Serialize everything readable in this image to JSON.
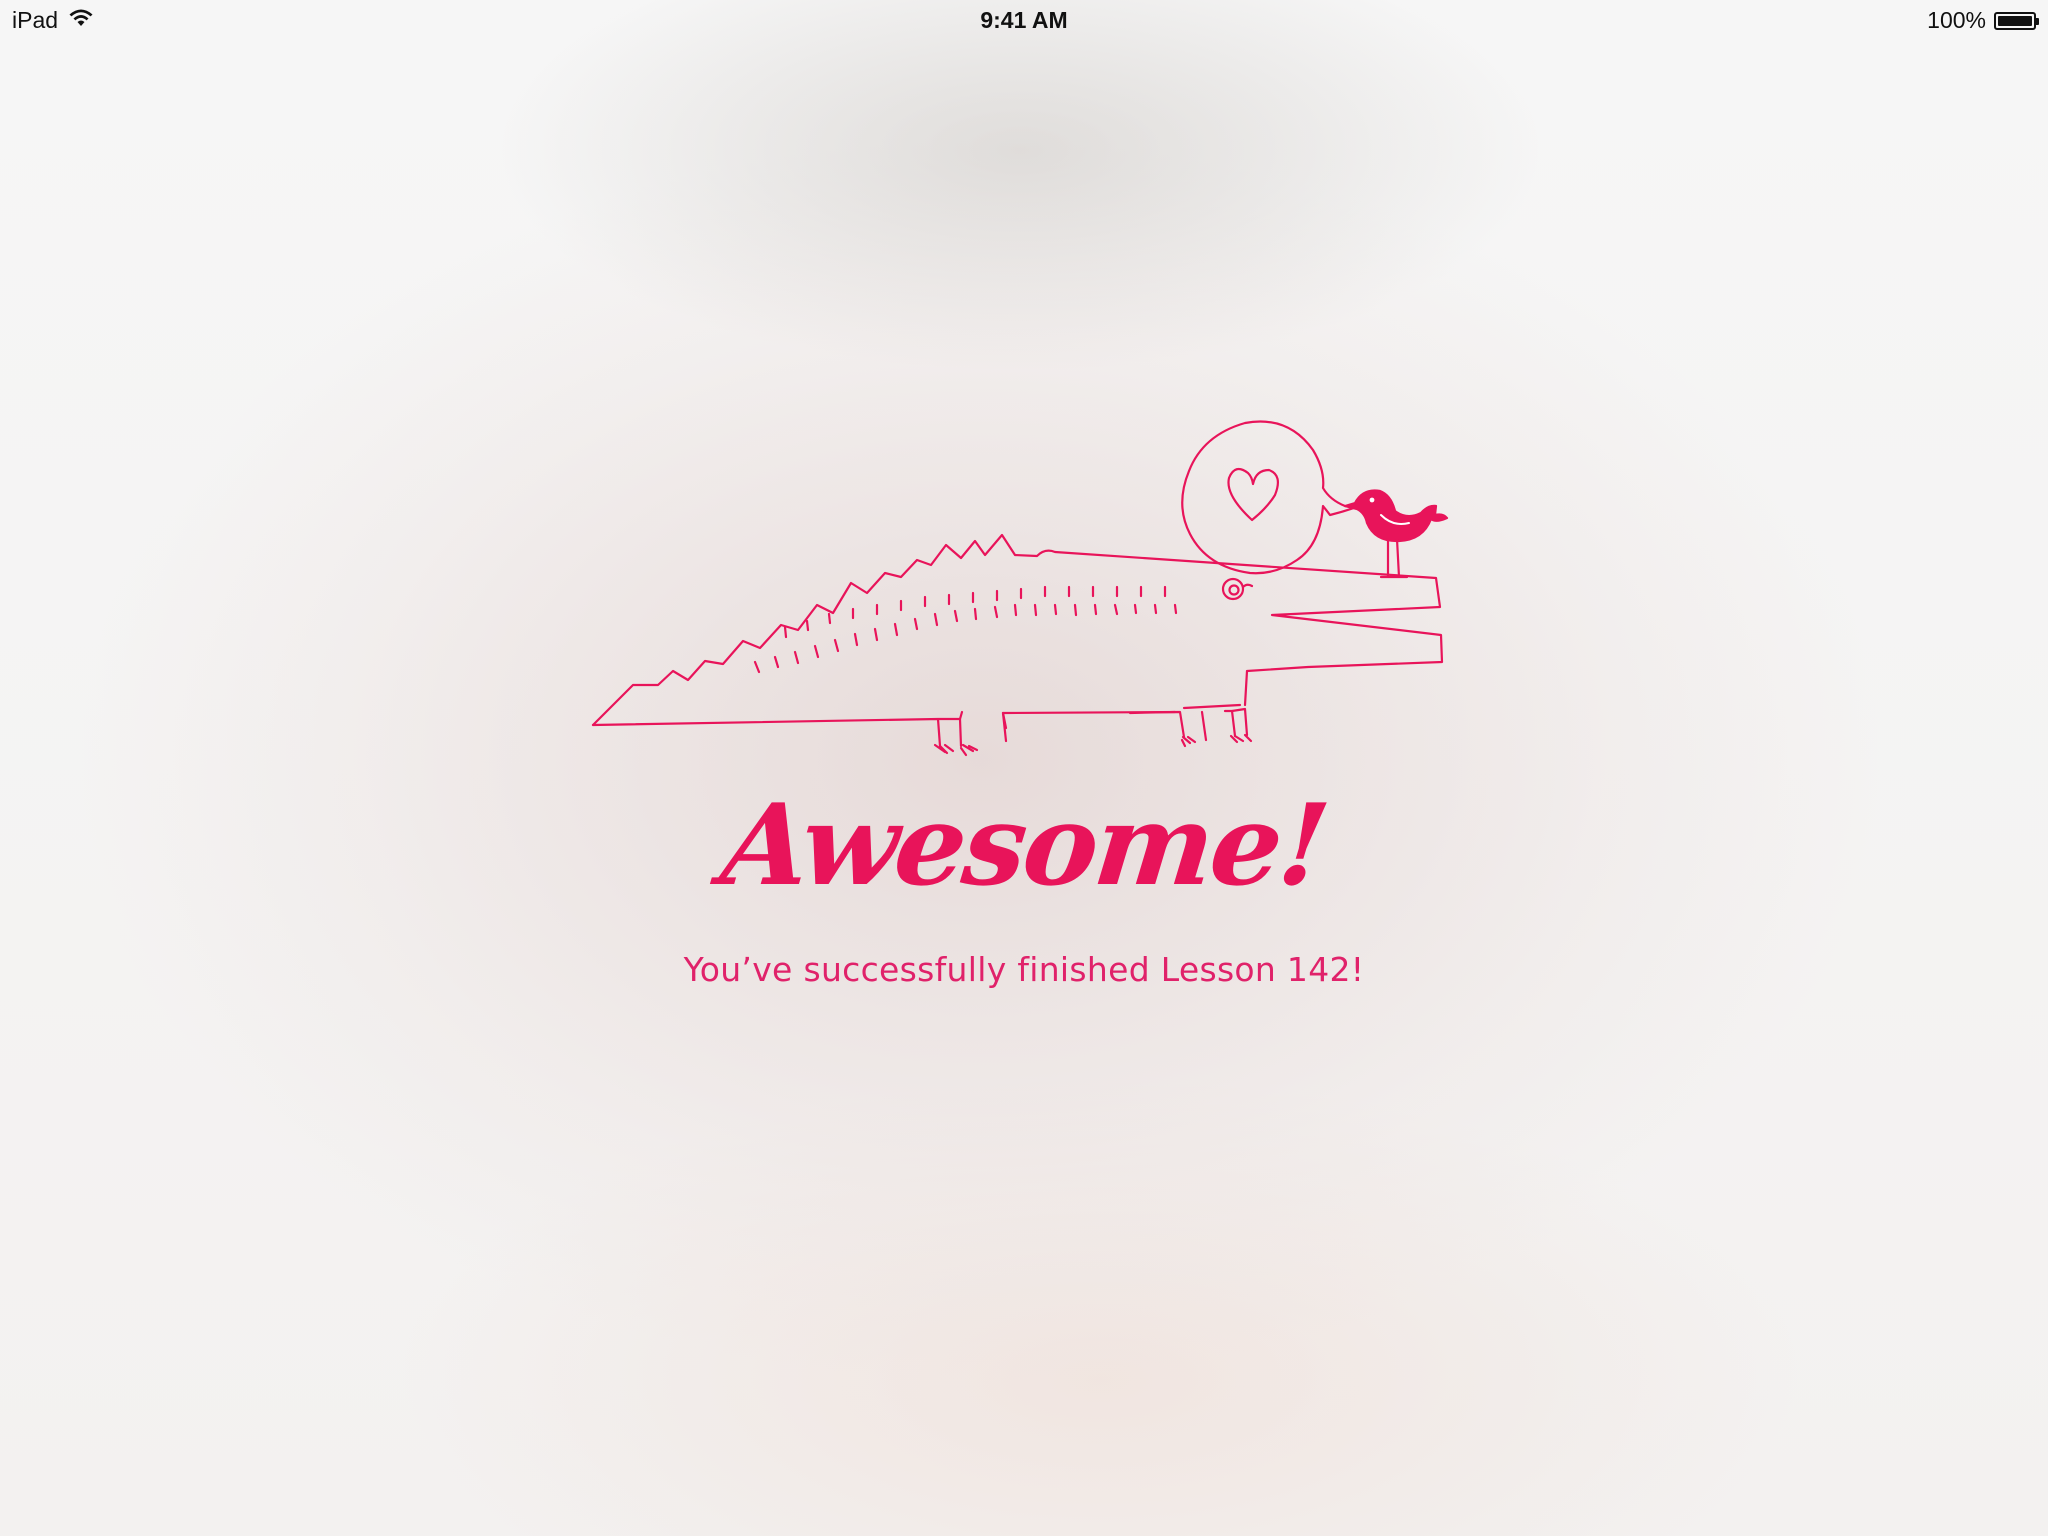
{
  "status_bar": {
    "device": "iPad",
    "time": "9:41 AM",
    "battery": "100%",
    "battery_level": 1.0,
    "icons": [
      "wifi-icon",
      "battery-icon"
    ]
  },
  "completion": {
    "headline": "Awesome!",
    "message": "You’ve successfully finished Lesson 142!",
    "illustration": "crocodile-with-bird-heart-illustration",
    "accent_color": "#e8145a"
  }
}
